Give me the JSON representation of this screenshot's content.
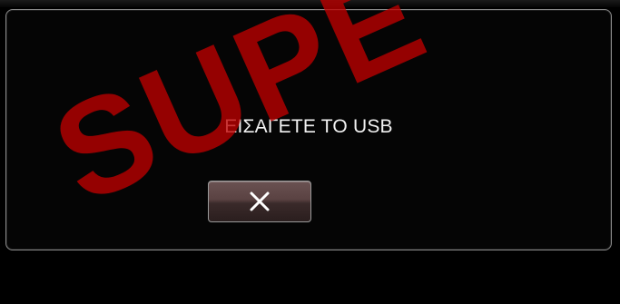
{
  "dialog": {
    "message": "ΕΙΣΑΓΕΤΕ ΤΟ USB",
    "close_icon": "close-icon"
  },
  "watermark": {
    "text": "SUPE"
  },
  "colors": {
    "background": "#000000",
    "panel_border": "#8a8a8a",
    "button_fill": "#5a4242",
    "text": "#f2f2f2",
    "watermark": "#be0000"
  }
}
